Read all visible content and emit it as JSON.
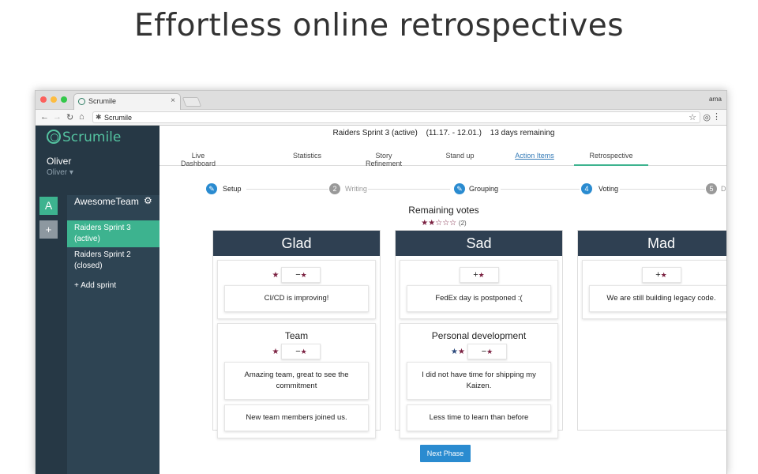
{
  "headline": "Effortless online retrospectives",
  "browser": {
    "tab_title": "Scrumile",
    "url": "Scrumile",
    "profile": "arna"
  },
  "sidebar": {
    "logo": "Scrumile",
    "user_name": "Oliver",
    "user_sub": "Oliver ▾",
    "team_initial": "A",
    "add_team": "+",
    "team_name": "AwesomeTeam",
    "sprints": [
      {
        "name": "Raiders Sprint 3",
        "status": "(active)"
      },
      {
        "name": "Raiders Sprint 2",
        "status": "(closed)"
      }
    ],
    "add_sprint": "+ Add sprint"
  },
  "sprint": {
    "name": "Raiders Sprint 3 (active)",
    "dates": "(11.17. - 12.01.)",
    "remaining": "13 days remaining"
  },
  "tabs": [
    "Live Dashboard",
    "Statistics",
    "Story Refinement",
    "Stand up",
    "Action Items",
    "Retrospective"
  ],
  "steps": [
    {
      "num": "",
      "label": "Setup",
      "state": "done"
    },
    {
      "num": "2",
      "label": "Writing",
      "state": "todo"
    },
    {
      "num": "",
      "label": "Grouping",
      "state": "done"
    },
    {
      "num": "4",
      "label": "Voting",
      "state": "current"
    },
    {
      "num": "5",
      "label": "Discussion",
      "state": "todo"
    }
  ],
  "votes": {
    "title": "Remaining votes",
    "stars": "★★☆☆☆",
    "count": "(2)"
  },
  "columns": {
    "glad": {
      "title": "Glad",
      "groups": [
        {
          "title": "",
          "stars": "★",
          "button": "−",
          "cards": [
            "CI/CD is improving!"
          ]
        },
        {
          "title": "Team",
          "stars": "★",
          "button": "−",
          "cards": [
            "Amazing team, great to see the commitment",
            "New team members joined us."
          ]
        }
      ]
    },
    "sad": {
      "title": "Sad",
      "groups": [
        {
          "title": "",
          "stars": "",
          "button": "+",
          "cards": [
            "FedEx day is postponed :("
          ]
        },
        {
          "title": "Personal development",
          "stars": "★★",
          "button": "−",
          "cards": [
            "I did not have time for shipping my Kaizen.",
            "Less time to learn than before"
          ]
        }
      ]
    },
    "mad": {
      "title": "Mad",
      "groups": [
        {
          "title": "",
          "stars": "",
          "button": "+",
          "cards": [
            "We are still building legacy code."
          ]
        }
      ]
    }
  },
  "next_button": "Next Phase",
  "colors": {
    "sidebar_dark": "#263845",
    "sidebar": "#2e4453",
    "accent_green": "#3db38f",
    "column_header": "#2f4052",
    "vote_star": "#7b2141",
    "button_blue": "#2a8bd0"
  }
}
